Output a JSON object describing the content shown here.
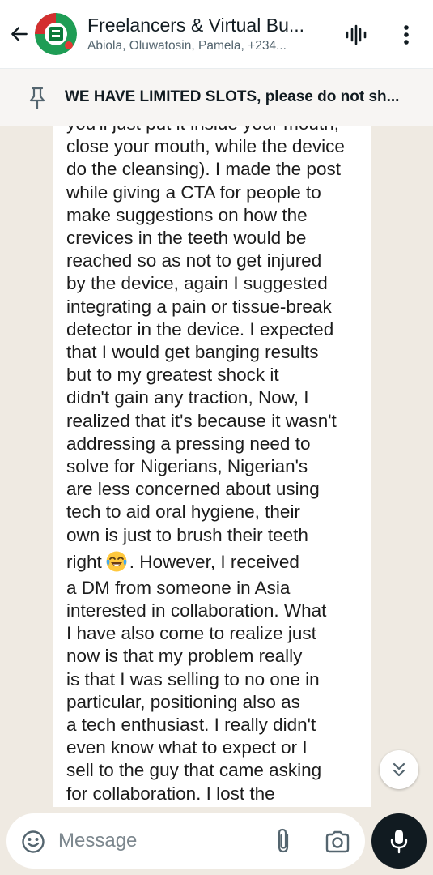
{
  "header": {
    "title": "Freelancers & Virtual Bu...",
    "subtitle": "Abiola, Oluwatosin, Pamela, +234..."
  },
  "pinned": {
    "text": "WE HAVE LIMITED SLOTS, please do not sh..."
  },
  "message": {
    "lines": [
      "you'll just put it inside your mouth,",
      "close your mouth, while the device",
      "do the cleansing). I made the post",
      "while giving a CTA for people to",
      "make suggestions on how the",
      "crevices in the teeth would be",
      "reached so as not to get injured",
      "by the device, again I suggested",
      "integrating a pain or tissue-break",
      "detector in the device. I expected",
      "that I would get banging results",
      "but to my greatest shock it",
      "didn't gain any traction, Now, I",
      "realized that it's because it wasn't",
      "addressing a pressing need to",
      "solve for Nigerians, Nigerian's",
      "are less concerned about using",
      "tech to aid oral hygiene, their",
      "own is just to brush their teeth"
    ],
    "emoji_line_before": "right",
    "emoji_line_after": ". However, I received",
    "emoji": "face-with-tears-of-joy",
    "lines_after": [
      "a DM from someone in Asia",
      "interested in collaboration. What",
      "I have also come to realize just",
      "now is that my problem really",
      "is that I was selling to no one in",
      "particular, positioning also as",
      "a tech enthusiast. I really didn't",
      "even know what to expect or I",
      "sell to the guy that came asking",
      "for collaboration. I lost the"
    ]
  },
  "composer": {
    "placeholder": "Message"
  },
  "colors": {
    "chat_background": "#efeae2",
    "bubble": "#ffffff",
    "mic_button": "#111b21"
  },
  "icons": {
    "back": "arrow-left-icon",
    "voice": "audio-wave-icon",
    "menu": "more-vertical-icon",
    "pin": "pin-icon",
    "scroll": "double-chevron-down-icon",
    "emoji": "emoji-smile-icon",
    "attach": "paperclip-icon",
    "camera": "camera-icon",
    "mic": "microphone-icon"
  }
}
